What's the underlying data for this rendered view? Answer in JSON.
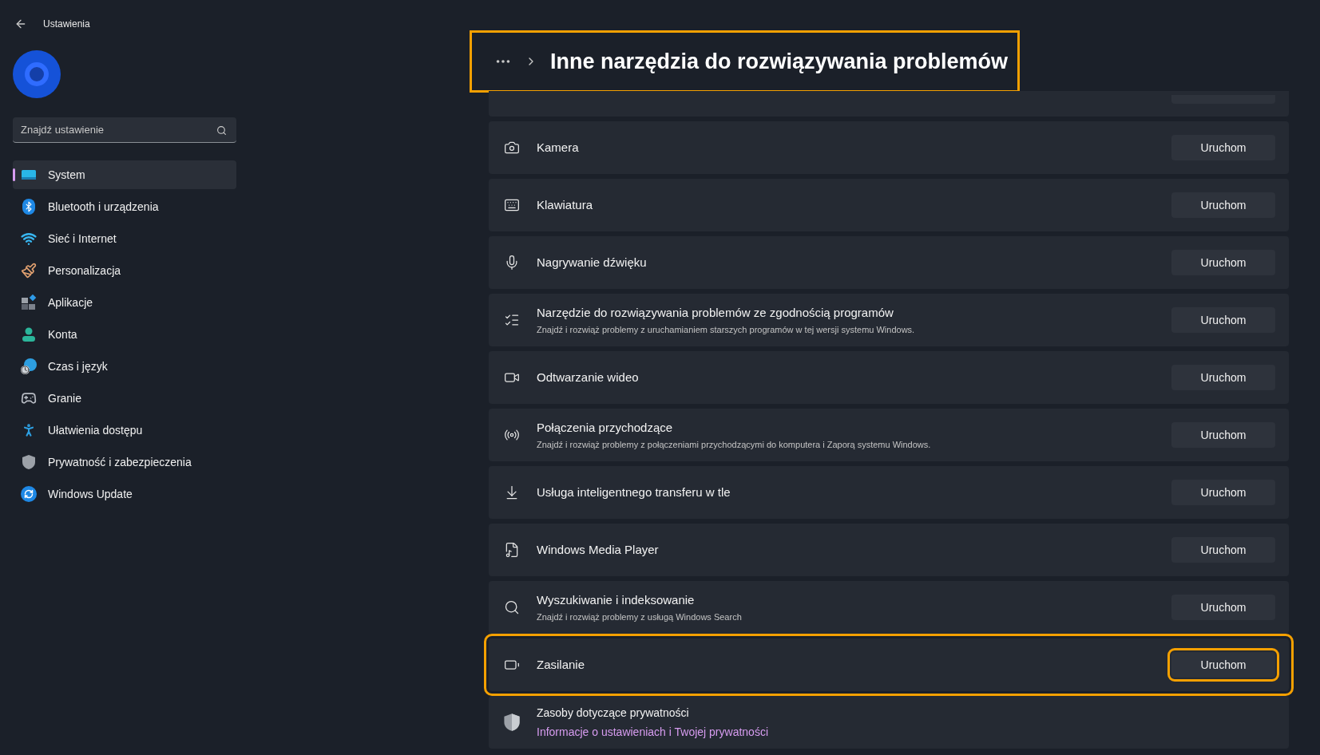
{
  "window": {
    "title": "Ustawienia"
  },
  "search": {
    "placeholder": "Znajdź ustawienie"
  },
  "sidebar": {
    "items": [
      {
        "label": "System",
        "kind": "system",
        "selected": true
      },
      {
        "label": "Bluetooth i urządzenia",
        "kind": "bluetooth",
        "selected": false
      },
      {
        "label": "Sieć i Internet",
        "kind": "wifi",
        "selected": false
      },
      {
        "label": "Personalizacja",
        "kind": "brush",
        "selected": false
      },
      {
        "label": "Aplikacje",
        "kind": "apps",
        "selected": false
      },
      {
        "label": "Konta",
        "kind": "account",
        "selected": false
      },
      {
        "label": "Czas i język",
        "kind": "time",
        "selected": false
      },
      {
        "label": "Granie",
        "kind": "gaming",
        "selected": false
      },
      {
        "label": "Ułatwienia dostępu",
        "kind": "accessibility",
        "selected": false
      },
      {
        "label": "Prywatność i zabezpieczenia",
        "kind": "shield",
        "selected": false
      },
      {
        "label": "Windows Update",
        "kind": "update",
        "selected": false
      }
    ]
  },
  "header": {
    "title": "Inne narzędzia do rozwiązywania problemów",
    "highlighted": true
  },
  "troubleshooters": [
    {
      "kind": "camera",
      "title": "Kamera",
      "button": "Uruchom",
      "highlighted": false
    },
    {
      "kind": "keyboard",
      "title": "Klawiatura",
      "button": "Uruchom",
      "highlighted": false
    },
    {
      "kind": "mic",
      "title": "Nagrywanie dźwięku",
      "button": "Uruchom",
      "highlighted": false
    },
    {
      "kind": "list",
      "title": "Narzędzie do rozwiązywania problemów ze zgodnością programów",
      "description": "Znajdź i rozwiąż problemy z uruchamianiem starszych programów w tej wersji systemu Windows.",
      "button": "Uruchom",
      "highlighted": false
    },
    {
      "kind": "video",
      "title": "Odtwarzanie wideo",
      "button": "Uruchom",
      "highlighted": false
    },
    {
      "kind": "antenna",
      "title": "Połączenia przychodzące",
      "description": "Znajdź i rozwiąż problemy z połączeniami przychodzącymi do komputera i Zaporą systemu Windows.",
      "button": "Uruchom",
      "highlighted": false
    },
    {
      "kind": "download",
      "title": "Usługa inteligentnego transferu w tle",
      "button": "Uruchom",
      "highlighted": false
    },
    {
      "kind": "media",
      "title": "Windows Media Player",
      "button": "Uruchom",
      "highlighted": false
    },
    {
      "kind": "search",
      "title": "Wyszukiwanie i indeksowanie",
      "description": "Znajdź i rozwiąż problemy z usługą Windows Search",
      "button": "Uruchom",
      "highlighted": false
    },
    {
      "kind": "battery",
      "title": "Zasilanie",
      "button": "Uruchom",
      "highlighted": true
    }
  ],
  "privacy": {
    "title": "Zasoby dotyczące prywatności",
    "link": "Informacje o ustawieniach i Twojej prywatności"
  }
}
